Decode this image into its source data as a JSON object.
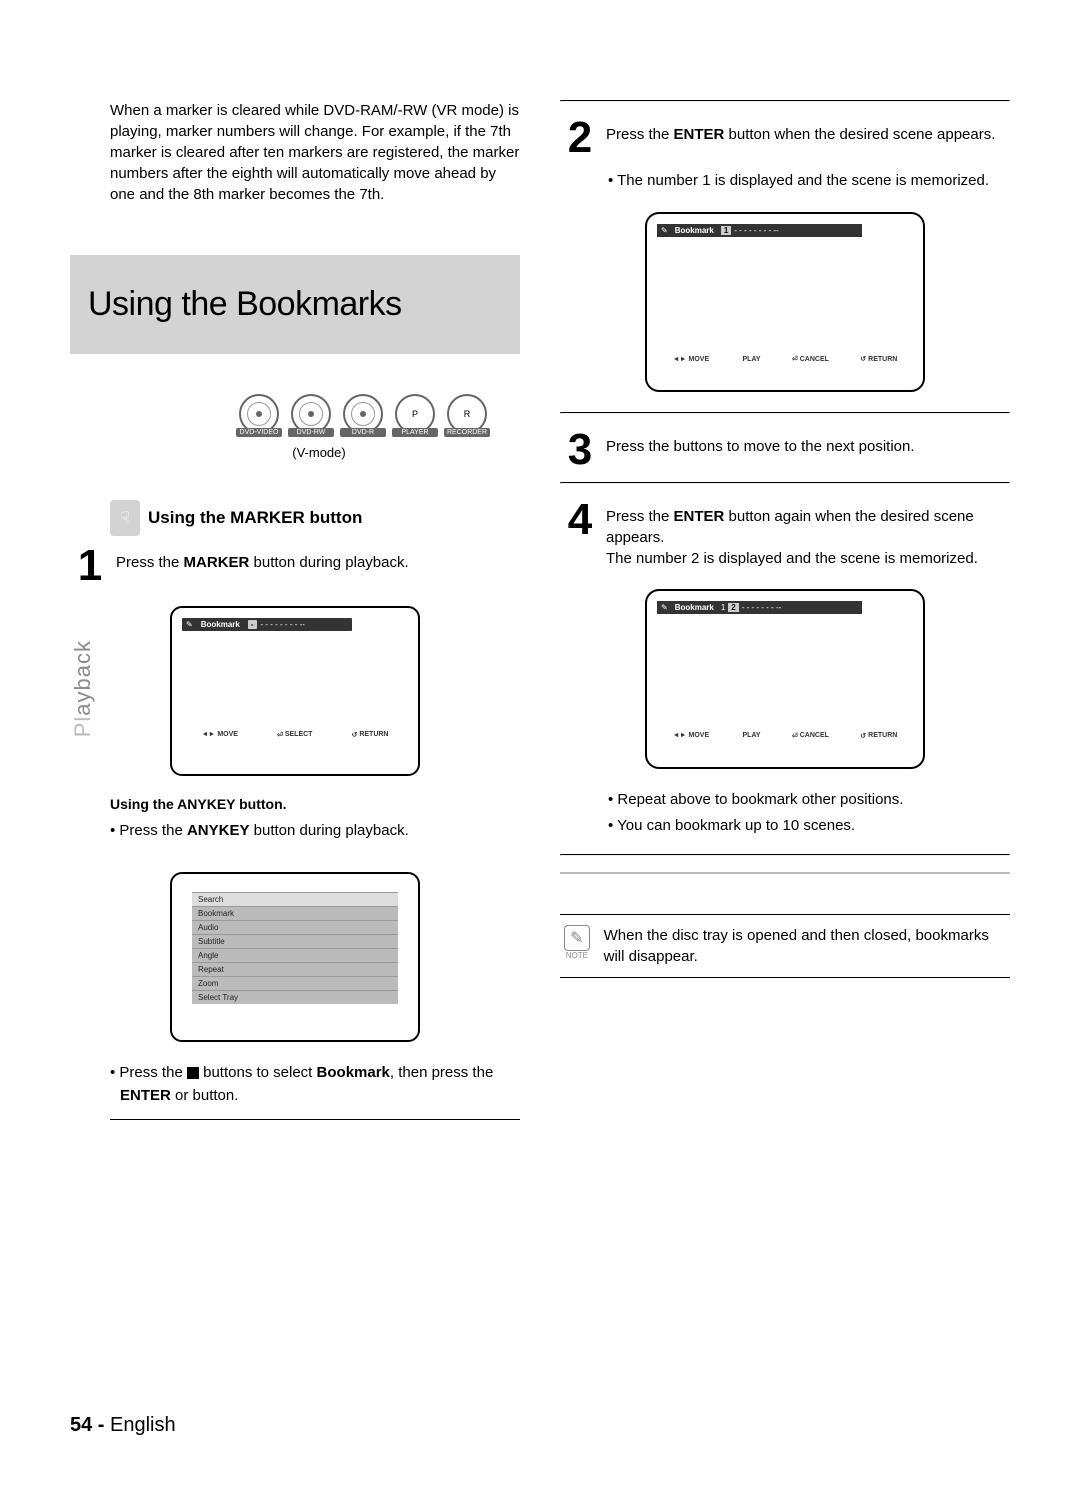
{
  "sideTab": {
    "full": "Playback",
    "grey": "Pl",
    "dark": "ayback"
  },
  "footer": {
    "page": "54 -",
    "lang": "English"
  },
  "left": {
    "intro": "When a marker is cleared while DVD-RAM/-RW (VR mode) is playing, marker numbers will change. For example, if the 7th marker is cleared after ten markers are registered, the marker numbers after the eighth will automatically move ahead by one and the 8th marker becomes the 7th.",
    "titleBox": "Using the Bookmarks",
    "discs": [
      "DVD-VIDEO",
      "DVD-RW",
      "DVD-R",
      "PLAYER",
      "RECORDER"
    ],
    "vmode": "(V-mode)",
    "sectionHeader": "Using the MARKER button",
    "step1": {
      "num": "1",
      "text_pre": "Press the ",
      "text_bold": "MARKER",
      "text_post": " button during playback."
    },
    "screen1": {
      "label": "Bookmark",
      "slot": "-",
      "bottom": [
        "MOVE",
        "SELECT",
        "RETURN"
      ]
    },
    "anykeyHeader": "Using the ANYKEY button.",
    "anykeyBullet_pre": "• Press the ",
    "anykeyBullet_bold": "ANYKEY",
    "anykeyBullet_post": " button during playback.",
    "menuItems": [
      "Search",
      "Bookmark",
      "Audio",
      "Subtitle",
      "Angle",
      "Repeat",
      "Zoom",
      "Select Tray"
    ],
    "pressSelect_pre": "• Press the ",
    "pressSelect_mid": " buttons to select ",
    "pressSelect_bold": "Bookmark",
    "pressSelect_mid2": ", then press the ",
    "pressSelect_bold2": "ENTER",
    "pressSelect_post": " or      button."
  },
  "right": {
    "step2": {
      "num": "2",
      "pre": "Press the ",
      "b": "ENTER",
      "post": " button when the desired scene appears."
    },
    "step2_bullet": "• The number 1 is displayed and the scene is memorized.",
    "screen2": {
      "label": "Bookmark",
      "hl": "1",
      "dashes": "- - - - - - - - --",
      "bottom": [
        "MOVE",
        "PLAY",
        "CANCEL",
        "RETURN"
      ]
    },
    "step3": {
      "num": "3",
      "pre": "Press the ",
      "mid": "       buttons to move to the next position."
    },
    "step4": {
      "num": "4",
      "pre": "Press the ",
      "b": "ENTER",
      "post": " button again when the desired scene appears.",
      "line2": "The number 2 is displayed and the scene is memorized."
    },
    "screen3": {
      "label": "Bookmark",
      "nums": "1",
      "hl": "2",
      "dashes": "- - - - - - - --",
      "bottom": [
        "MOVE",
        "PLAY",
        "CANCEL",
        "RETURN"
      ]
    },
    "repeatBullet": "• Repeat above to bookmark other positions.",
    "limitBullet": "• You can bookmark up to 10 scenes.",
    "note": {
      "label": "NOTE",
      "text": "When the disc tray is opened and then closed, bookmarks will disappear."
    }
  }
}
